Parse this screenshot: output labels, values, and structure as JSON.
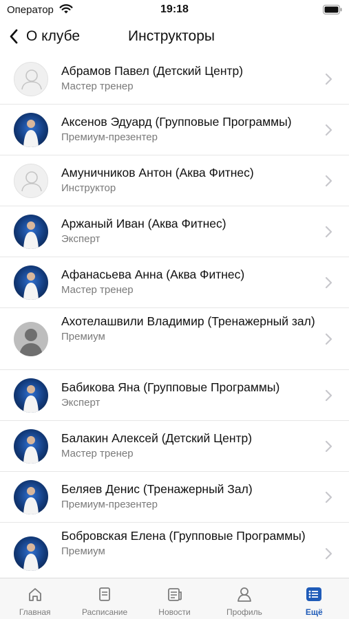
{
  "status_bar": {
    "carrier": "Оператор",
    "time": "19:18"
  },
  "nav": {
    "back_label": "О клубе",
    "title": "Инструкторы"
  },
  "instructors": [
    {
      "name": "Абрамов Павел (Детский Центр)",
      "role": "Мастер тренер",
      "avatar": "placeholder"
    },
    {
      "name": "Аксенов Эдуард (Групповые Программы)",
      "role": "Премиум-презентер",
      "avatar": "photo"
    },
    {
      "name": "Амуничников Антон (Аква Фитнес)",
      "role": "Инструктор",
      "avatar": "placeholder"
    },
    {
      "name": "Аржаный Иван (Аква Фитнес)",
      "role": "Эксперт",
      "avatar": "photo"
    },
    {
      "name": "Афанасьева Анна (Аква Фитнес)",
      "role": "Мастер тренер",
      "avatar": "photo"
    },
    {
      "name": "Ахотелашвили Владимир (Тренажерный зал)",
      "role": "Премиум",
      "avatar": "gray"
    },
    {
      "name": "Бабикова Яна (Групповые Программы)",
      "role": "Эксперт",
      "avatar": "photo"
    },
    {
      "name": "Балакин Алексей (Детский Центр)",
      "role": "Мастер тренер",
      "avatar": "photo"
    },
    {
      "name": "Беляев Денис (Тренажерный Зал)",
      "role": "Премиум-презентер",
      "avatar": "photo"
    },
    {
      "name": "Бобровская Елена (Групповые Программы)",
      "role": "Премиум",
      "avatar": "photo"
    }
  ],
  "tabs": [
    {
      "label": "Главная",
      "icon": "home-icon"
    },
    {
      "label": "Расписание",
      "icon": "schedule-icon"
    },
    {
      "label": "Новости",
      "icon": "news-icon"
    },
    {
      "label": "Профиль",
      "icon": "profile-icon"
    },
    {
      "label": "Ещё",
      "icon": "more-icon",
      "active": true
    }
  ],
  "colors": {
    "accent": "#1f5bb8",
    "secondary_text": "#7a7a7a",
    "tab_inactive": "#7b7b7b"
  }
}
